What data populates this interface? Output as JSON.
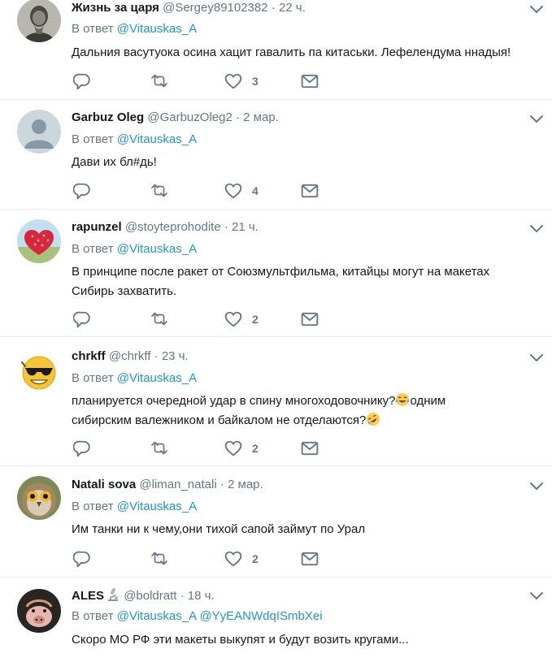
{
  "reply_prefix": "В ответ",
  "tweets": [
    {
      "name": "Жизнь за царя",
      "handle": "@Sergey89102382",
      "time": "22 ч.",
      "mentions": [
        "@Vitauskas_A"
      ],
      "text_lines": [
        "Дальния васутуока осина хацит гавалить па китаськи. Лефелендума ннадыя!"
      ],
      "likes": "3"
    },
    {
      "name": "Garbuz Oleg",
      "handle": "@GarbuzOleg2",
      "time": "2 мар.",
      "mentions": [
        "@Vitauskas_A"
      ],
      "text_lines": [
        "Дави их бл#дь!"
      ],
      "likes": "4"
    },
    {
      "name": "rapunzel",
      "handle": "@stoyteprohodite",
      "time": "21 ч.",
      "mentions": [
        "@Vitauskas_A"
      ],
      "text_lines": [
        "В принципе после ракет от Союзмультфильма, китайцы могут на макетах",
        "Сибирь захватить."
      ],
      "likes": "2"
    },
    {
      "name": "chrkff",
      "handle": "@chrkff",
      "time": "23 ч.",
      "mentions": [
        "@Vitauskas_A"
      ],
      "text_a": "планируется очередной удар в спину многоходовочнику?",
      "text_b": "одним",
      "text_c": "сибирским валежником и байкалом не отделаются?",
      "likes": "2"
    },
    {
      "name": "Natali sova",
      "handle": "@liman_natali",
      "time": "2 мар.",
      "mentions": [
        "@Vitauskas_A"
      ],
      "text_lines": [
        "Им танки ни к чему,они тихой сапой займут по Урал"
      ],
      "likes": "2"
    },
    {
      "name": "ALES",
      "handle": "@boldratt",
      "time": "18 ч.",
      "mentions": [
        "@Vitauskas_A",
        "@YyEANWdqISmbXei"
      ],
      "text_lines": [
        "Скоро МО РФ эти макеты выкупят и будут возить кругами..."
      ],
      "likes": ""
    }
  ],
  "colors": {
    "link": "#1b95e0",
    "secondary": "#657786",
    "divider": "#e6ecf0"
  },
  "icons": {
    "reply": "reply-icon",
    "retweet": "retweet-icon",
    "like": "heart-icon",
    "dm": "envelope-icon",
    "menu": "chevron-down-icon"
  }
}
